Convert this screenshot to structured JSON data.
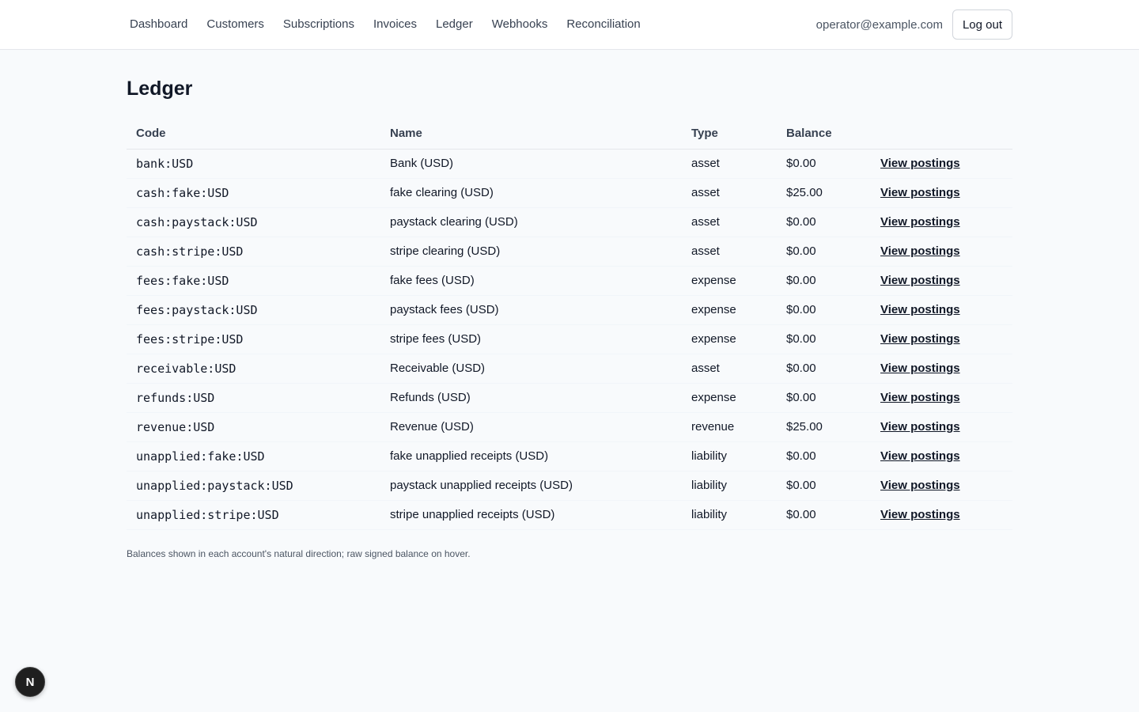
{
  "nav": {
    "items": [
      {
        "label": "Dashboard"
      },
      {
        "label": "Customers"
      },
      {
        "label": "Subscriptions"
      },
      {
        "label": "Invoices"
      },
      {
        "label": "Ledger"
      },
      {
        "label": "Webhooks"
      },
      {
        "label": "Reconciliation"
      }
    ]
  },
  "user": {
    "email": "operator@example.com",
    "logout_label": "Log out"
  },
  "page": {
    "title": "Ledger"
  },
  "table": {
    "columns": [
      "Code",
      "Name",
      "Type",
      "Balance",
      ""
    ],
    "rows": [
      {
        "code": "bank:USD",
        "name": "Bank (USD)",
        "type": "asset",
        "balance": "$0.00",
        "action": "View postings"
      },
      {
        "code": "cash:fake:USD",
        "name": "fake clearing (USD)",
        "type": "asset",
        "balance": "$25.00",
        "action": "View postings"
      },
      {
        "code": "cash:paystack:USD",
        "name": "paystack clearing (USD)",
        "type": "asset",
        "balance": "$0.00",
        "action": "View postings"
      },
      {
        "code": "cash:stripe:USD",
        "name": "stripe clearing (USD)",
        "type": "asset",
        "balance": "$0.00",
        "action": "View postings"
      },
      {
        "code": "fees:fake:USD",
        "name": "fake fees (USD)",
        "type": "expense",
        "balance": "$0.00",
        "action": "View postings"
      },
      {
        "code": "fees:paystack:USD",
        "name": "paystack fees (USD)",
        "type": "expense",
        "balance": "$0.00",
        "action": "View postings"
      },
      {
        "code": "fees:stripe:USD",
        "name": "stripe fees (USD)",
        "type": "expense",
        "balance": "$0.00",
        "action": "View postings"
      },
      {
        "code": "receivable:USD",
        "name": "Receivable (USD)",
        "type": "asset",
        "balance": "$0.00",
        "action": "View postings"
      },
      {
        "code": "refunds:USD",
        "name": "Refunds (USD)",
        "type": "expense",
        "balance": "$0.00",
        "action": "View postings"
      },
      {
        "code": "revenue:USD",
        "name": "Revenue (USD)",
        "type": "revenue",
        "balance": "$25.00",
        "action": "View postings"
      },
      {
        "code": "unapplied:fake:USD",
        "name": "fake unapplied receipts (USD)",
        "type": "liability",
        "balance": "$0.00",
        "action": "View postings"
      },
      {
        "code": "unapplied:paystack:USD",
        "name": "paystack unapplied receipts (USD)",
        "type": "liability",
        "balance": "$0.00",
        "action": "View postings"
      },
      {
        "code": "unapplied:stripe:USD",
        "name": "stripe unapplied receipts (USD)",
        "type": "liability",
        "balance": "$0.00",
        "action": "View postings"
      }
    ]
  },
  "footnote": "Balances shown in each account's natural direction; raw signed balance on hover.",
  "dev_badge": {
    "letter": "N",
    "icon": "nextjs-dev-icon"
  },
  "colors": {
    "background": "#f8fafc",
    "header_bg": "#ffffff",
    "text": "#111827",
    "muted": "#4b5563",
    "border": "#e5e7eb"
  }
}
